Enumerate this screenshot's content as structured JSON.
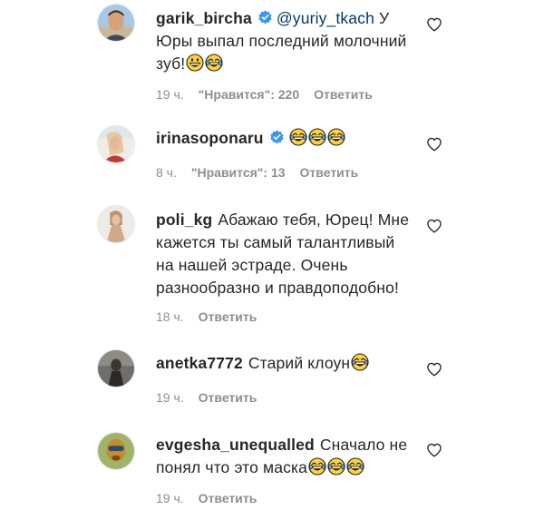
{
  "comments": [
    {
      "username": "garik_bircha",
      "verified": true,
      "mention": "@yuriy_tkach",
      "text": " У Юры выпал последний молочний зуб!",
      "time": "19 ч.",
      "likes": "\"Нравится\": 220",
      "reply": "Ответить"
    },
    {
      "username": "irinasoponaru",
      "verified": true,
      "text": "",
      "time": "8 ч.",
      "likes": "\"Нравится\": 13",
      "reply": "Ответить"
    },
    {
      "username": "poli_kg",
      "verified": false,
      "text": "Абажаю тебя, Юрец! Мне кажется ты самый талантливый на нашей эстраде. Очень разнообразно и правдоподобно!",
      "time": "18 ч.",
      "reply": "Ответить"
    },
    {
      "username": "anetka7772",
      "verified": false,
      "text": "Старий клоун",
      "time": "19 ч.",
      "reply": "Ответить"
    },
    {
      "username": "evgesha_unequalled",
      "verified": false,
      "text": "Сначало не понял что это маска",
      "time": "19 ч.",
      "reply": "Ответить"
    }
  ],
  "colors": {
    "mention": "#00376b",
    "verified": "#3897f0",
    "meta": "#8e8e8e",
    "text": "#262626"
  }
}
